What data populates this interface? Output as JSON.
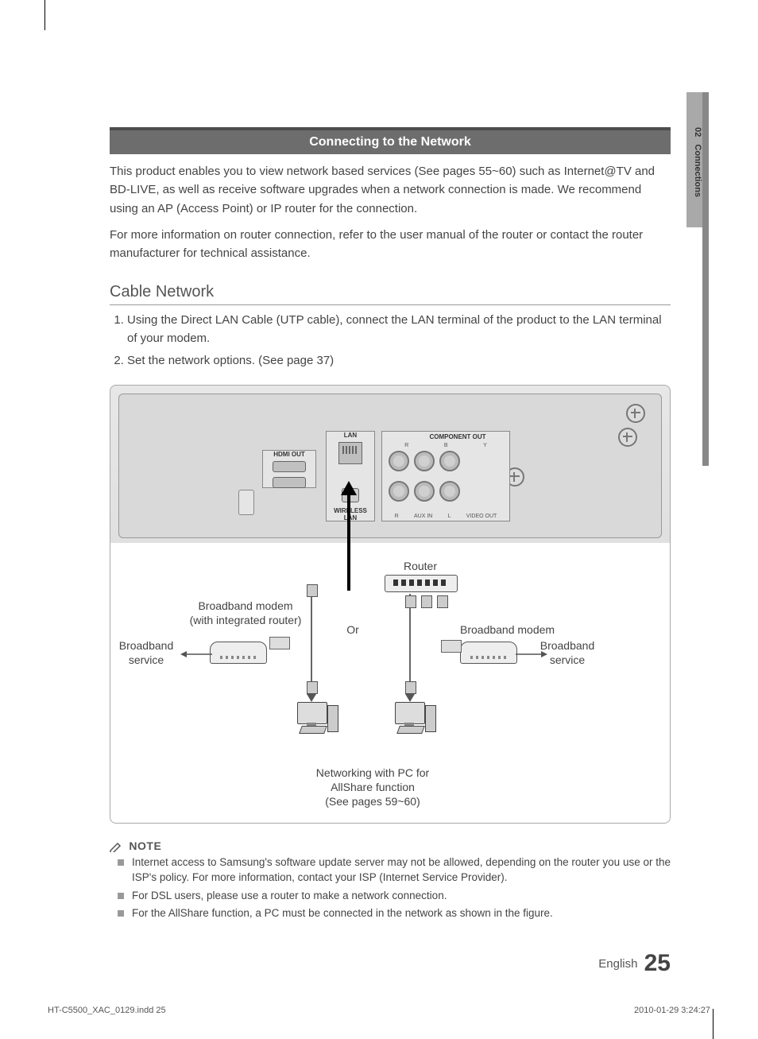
{
  "side_tab": {
    "chapter": "02",
    "name": "Connections"
  },
  "banner_title": "Connecting to the Network",
  "intro": {
    "p1": "This product enables you to view network based services (See pages 55~60) such as Internet@TV and BD-LIVE, as well as receive software upgrades when a network connection is made. We recommend using an AP (Access Point) or IP router for the connection.",
    "p2": "For more information on router connection, refer to the user manual of the router or contact the router manufacturer for technical assistance."
  },
  "subheading": "Cable Network",
  "steps": [
    "Using the Direct LAN Cable (UTP cable), connect the LAN terminal of the product to the LAN terminal of your modem.",
    "Set the network options. (See page 37)"
  ],
  "diagram": {
    "port_labels": {
      "lan": "LAN",
      "hdmi_out": "HDMI OUT",
      "component_out": "COMPONENT OUT",
      "wireless_lan": "WIRELESS LAN",
      "aux_in": "AUX IN",
      "video_out": "VIDEO OUT",
      "r": "R",
      "b": "B",
      "y": "Y",
      "r2": "R",
      "l": "L"
    },
    "labels": {
      "router": "Router",
      "or": "Or",
      "modem_router": "Broadband modem\n(with integrated router)",
      "modem": "Broadband modem",
      "broadband_service": "Broadband\nservice",
      "pc_note": "Networking with PC for\nAllShare function\n(See pages 59~60)"
    }
  },
  "note": {
    "heading": "NOTE",
    "items": [
      "Internet access to Samsung's software update server may not be allowed, depending on the router you use or the ISP's policy. For more information, contact your ISP (Internet Service Provider).",
      "For DSL users, please use a router to make a network connection.",
      "For the AllShare function, a PC must be connected in the network as shown in the figure."
    ]
  },
  "footer": {
    "lang": "English",
    "page": "25"
  },
  "print": {
    "file": "HT-C5500_XAC_0129.indd   25",
    "datetime": "2010-01-29   3:24:27"
  }
}
